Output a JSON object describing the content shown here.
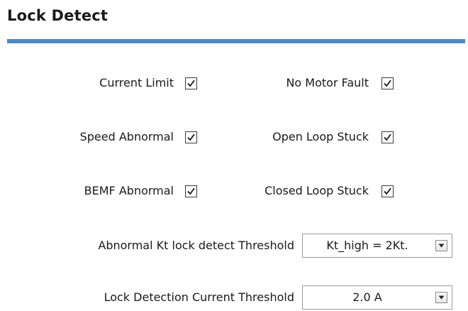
{
  "panel": {
    "title": "Lock Detect"
  },
  "checkboxes": {
    "current_limit": {
      "label": "Current Limit",
      "checked": true
    },
    "no_motor_fault": {
      "label": "No Motor Fault",
      "checked": true
    },
    "speed_abnormal": {
      "label": "Speed Abnormal",
      "checked": true
    },
    "open_loop_stuck": {
      "label": "Open Loop Stuck",
      "checked": true
    },
    "bemf_abnormal": {
      "label": "BEMF Abnormal",
      "checked": true
    },
    "closed_loop_stuck": {
      "label": "Closed Loop Stuck",
      "checked": true
    }
  },
  "fields": {
    "kt_threshold": {
      "label": "Abnormal Kt lock detect Threshold",
      "value": "Kt_high = 2Kt."
    },
    "current_threshold": {
      "label": "Lock Detection Current Threshold",
      "value": "2.0 A"
    }
  },
  "colors": {
    "accent_rule": "#4f88c6"
  },
  "icons": {
    "checkmark": "check-icon",
    "dropdown": "chevron-down-icon"
  }
}
